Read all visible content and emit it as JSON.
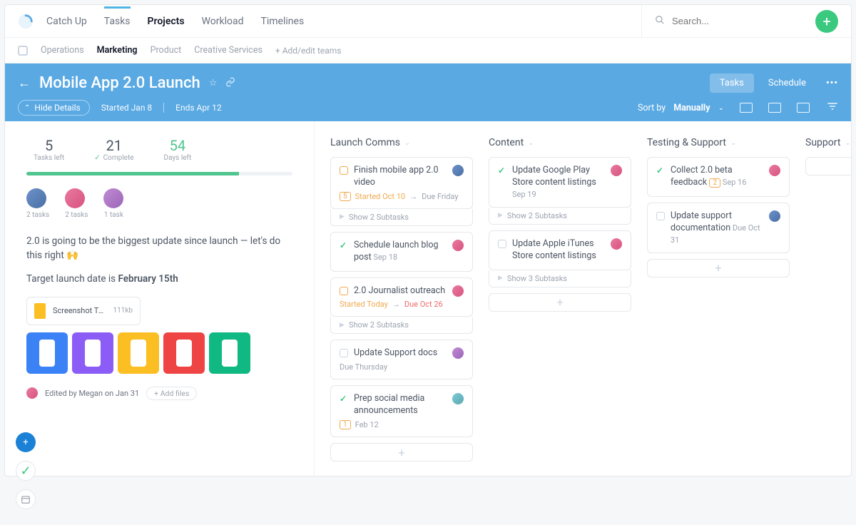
{
  "nav": {
    "items": [
      "Catch Up",
      "Tasks",
      "Projects",
      "Workload",
      "Timelines"
    ],
    "active_index": 2
  },
  "search": {
    "placeholder": "Search..."
  },
  "teams": {
    "items": [
      "Operations",
      "Marketing",
      "Product",
      "Creative Services"
    ],
    "active_index": 1,
    "add": "+ Add/edit teams"
  },
  "project": {
    "title": "Mobile App 2.0 Launch",
    "tabs": {
      "tasks": "Tasks",
      "schedule": "Schedule"
    },
    "hide_details": "Hide Details",
    "started": "Started Jan 8",
    "ends": "Ends Apr 12",
    "sort": {
      "prefix": "Sort by",
      "value": "Manually"
    }
  },
  "stats": {
    "tasks_left": {
      "num": "5",
      "label": "Tasks left"
    },
    "complete": {
      "num": "21",
      "label": "Complete"
    },
    "days_left": {
      "num": "54",
      "label": "Days left"
    }
  },
  "people": [
    {
      "tasks": "2 tasks"
    },
    {
      "tasks": "2 tasks"
    },
    {
      "tasks": "1 task"
    }
  ],
  "description": {
    "l1_a": "2.0 is going to be the biggest update since launch — let's do this right 🙌",
    "l2_a": "Target launch date is ",
    "l2_b": "February 15th"
  },
  "attachment": {
    "name": "Screenshot Temp...",
    "size": "111kb"
  },
  "edited": {
    "text": "Edited by Megan on Jan 31",
    "addfiles": "+ Add files"
  },
  "columns": [
    {
      "title": "Launch Comms",
      "cards": [
        {
          "status": "open",
          "title": "Finish mobile app 2.0 video",
          "badge": "5",
          "meta": [
            {
              "t": "Started Oct 10",
              "c": "or"
            },
            {
              "t": " → ",
              "c": ""
            },
            {
              "t": "Due Friday",
              "c": ""
            }
          ],
          "avatar": "a1",
          "sub": "Show 2 Subtasks"
        },
        {
          "status": "done",
          "title": "Schedule launch blog post",
          "meta": [
            {
              "t": "Sep 18",
              "c": ""
            }
          ],
          "avatar": "a2",
          "inline": true
        },
        {
          "status": "open",
          "title": "2.0 Journalist outreach",
          "meta": [
            {
              "t": "Started Today",
              "c": "or"
            },
            {
              "t": " → ",
              "c": ""
            },
            {
              "t": "Due Oct 26",
              "c": "red"
            }
          ],
          "avatar": "a2",
          "sub": "Show 2 Subtasks"
        },
        {
          "status": "empty",
          "title": "Update Support docs",
          "meta": [
            {
              "t": "Due Thursday",
              "c": ""
            }
          ],
          "avatar": "a3"
        },
        {
          "status": "done",
          "title": "Prep social media announcements",
          "badge": "1",
          "meta": [
            {
              "t": "Feb 12",
              "c": ""
            }
          ],
          "avatar": "a4"
        }
      ]
    },
    {
      "title": "Content",
      "cards": [
        {
          "status": "done",
          "title": "Update Google Play Store content listings",
          "meta": [
            {
              "t": "Sep 19",
              "c": ""
            }
          ],
          "avatar": "a2",
          "inline": true,
          "sub": "Show 2 Subtasks"
        },
        {
          "status": "empty",
          "title": "Update Apple iTunes Store content listings",
          "avatar": "a2",
          "sub": "Show 3 Subtasks"
        }
      ]
    },
    {
      "title": "Testing & Support",
      "cards": [
        {
          "status": "done",
          "title": "Collect 2.0 beta feedback",
          "badge": "2",
          "meta": [
            {
              "t": "Sep 16",
              "c": ""
            }
          ],
          "avatar": "a2",
          "inline": true
        },
        {
          "status": "empty",
          "title": "Update support documentation",
          "meta": [
            {
              "t": "Due Oct 31",
              "c": ""
            }
          ],
          "avatar": "a1",
          "inline": true
        }
      ]
    },
    {
      "title": "Support",
      "cards": [],
      "partial": true
    }
  ]
}
